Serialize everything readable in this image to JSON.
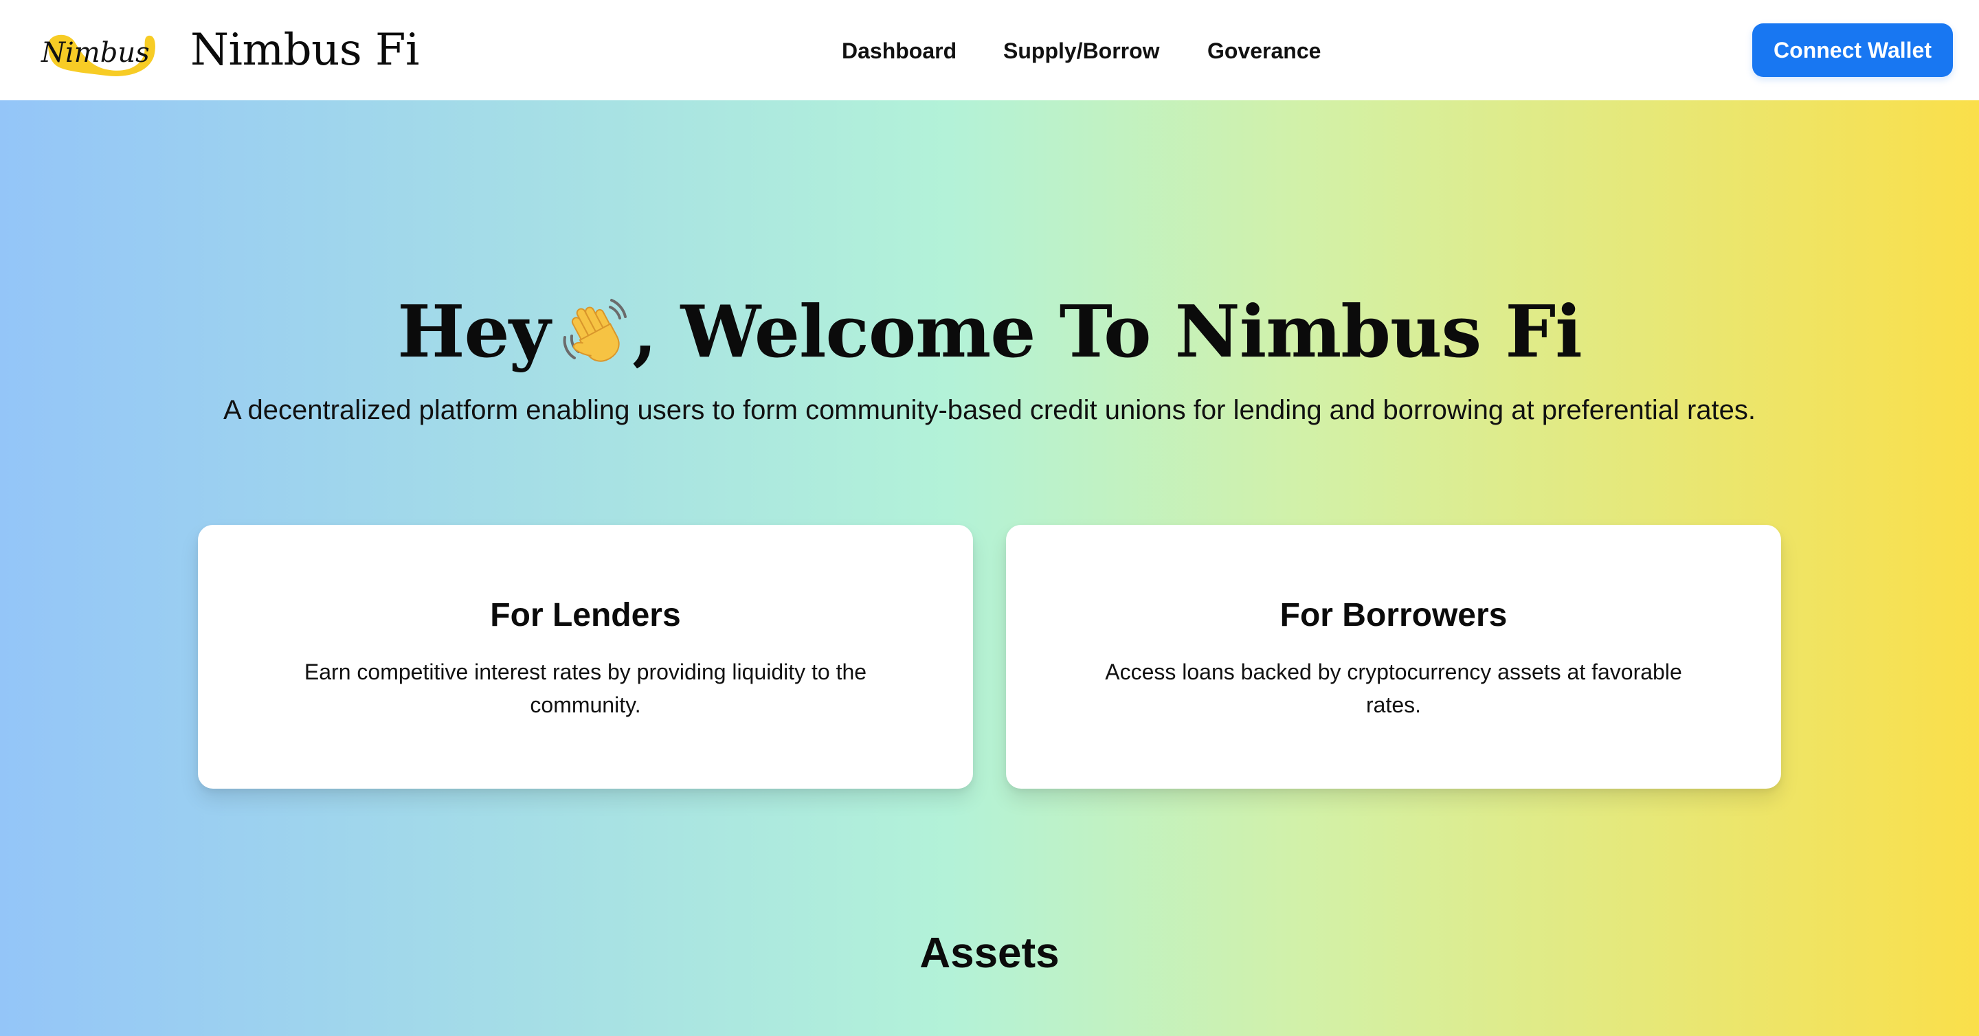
{
  "header": {
    "logo_text": "Nimbus",
    "brand_name": "Nimbus Fi",
    "nav": {
      "dashboard": "Dashboard",
      "supply_borrow": "Supply/Borrow",
      "governance": "Goverance"
    },
    "connect_wallet_label": "Connect Wallet"
  },
  "hero": {
    "title_prefix": "Hey",
    "title_suffix": ", Welcome To Nimbus Fi",
    "subtitle": "A decentralized platform enabling users to form community-based credit unions for lending and borrowing at preferential rates.",
    "cards": [
      {
        "title": "For Lenders",
        "text": "Earn competitive interest rates by providing liquidity to the community."
      },
      {
        "title": "For Borrowers",
        "text": "Access loans backed by cryptocurrency assets at favorable rates."
      }
    ],
    "assets_heading": "Assets"
  },
  "icons": {
    "title_emoji": "waving-hand-icon"
  },
  "colors": {
    "accent": "#1877f2",
    "gradient_left": "#94c5f8",
    "gradient_mid": "#b3f2d8",
    "gradient_right": "#fadf4a",
    "logo_yellow": "#f7cc25"
  }
}
